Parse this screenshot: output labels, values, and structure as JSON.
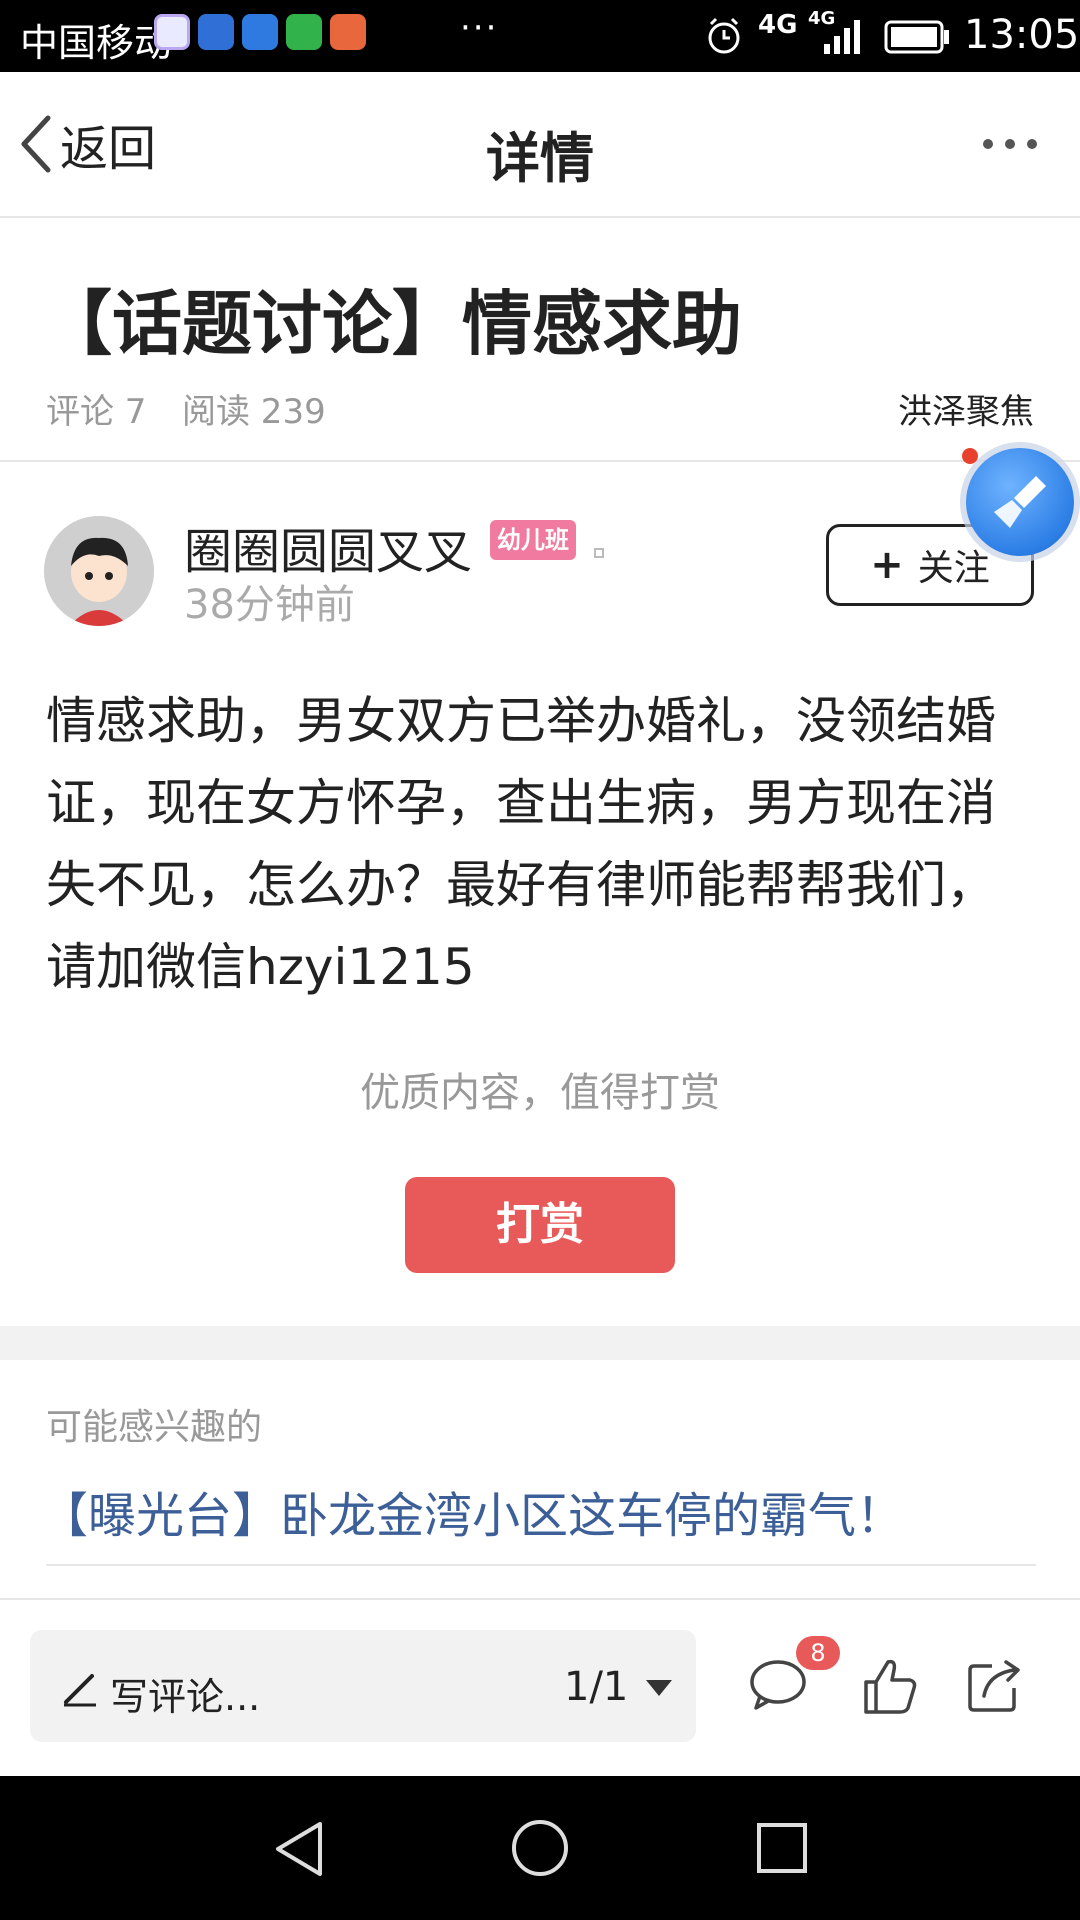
{
  "status_bar": {
    "carrier": "中国移动",
    "apps": [
      "video-app-icon",
      "app-icon",
      "shield-app-icon",
      "wechat-icon",
      "mail-app-icon"
    ],
    "overflow": "···",
    "network_primary": "4G",
    "network_secondary": "4G",
    "time": "13:05"
  },
  "nav": {
    "back_label": "返回",
    "title": "详情"
  },
  "article": {
    "title": "【话题讨论】情感求助",
    "comments": "评论 7",
    "reads": "阅读 239",
    "source": "洪泽聚焦"
  },
  "author": {
    "name": "圈圈圆圆叉叉",
    "badge": "幼儿班",
    "time": "38分钟前",
    "follow_label": "关注",
    "follow_plus": "+"
  },
  "body": "情感求助，男女双方已举办婚礼，没领结婚证，现在女方怀孕，查出生病，男方现在消失不见，怎么办？最好有律师能帮帮我们，请加微信hzyi1215",
  "reward": {
    "hint": "优质内容，值得打赏",
    "button": "打赏"
  },
  "related": {
    "header": "可能感兴趣的",
    "items": [
      "【曝光台】卧龙金湾小区这车停的霸气！"
    ]
  },
  "bottom_bar": {
    "comment_placeholder": "写评论...",
    "page_indicator": "1/1",
    "comment_count": "8"
  },
  "colors": {
    "accent_red": "#e85a5a",
    "badge_pink": "#f17aa0",
    "link_blue": "#3d5f98"
  }
}
